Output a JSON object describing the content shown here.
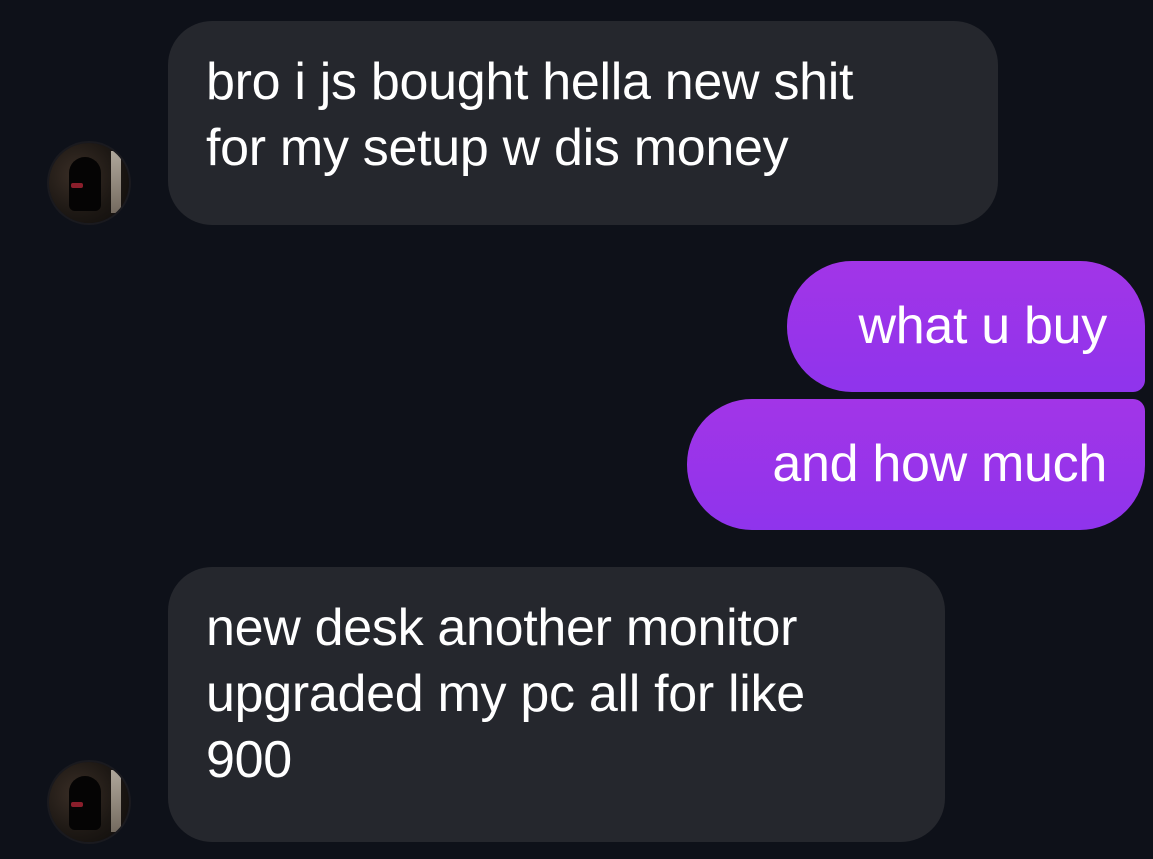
{
  "messages": [
    {
      "sender": "other",
      "lines": [
        "bro i js bought hella new shit",
        "for my setup w dis money"
      ]
    },
    {
      "sender": "me",
      "lines": [
        "what u buy"
      ]
    },
    {
      "sender": "me",
      "lines": [
        "and how much"
      ]
    },
    {
      "sender": "other",
      "lines": [
        "new desk another monitor",
        "upgraded my pc all for like",
        "900"
      ]
    }
  ],
  "avatars": [
    {
      "icon": "contact-avatar-icon"
    },
    {
      "icon": "contact-avatar-icon"
    }
  ],
  "colors": {
    "background": "#0e1119",
    "incoming_bubble": "#25272d",
    "outgoing_bubble_top": "#a235e7",
    "outgoing_bubble_bottom": "#8f34ec",
    "text": "#ffffff"
  }
}
